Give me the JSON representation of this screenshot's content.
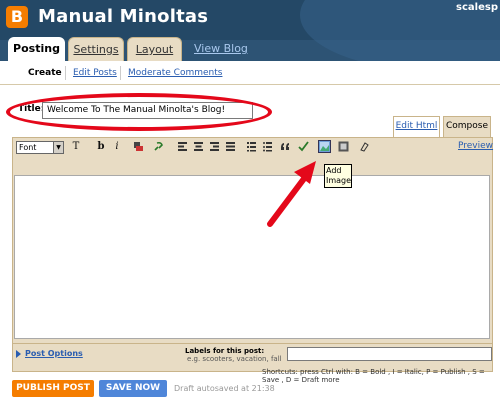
{
  "header": {
    "blog_title": "Manual Minoltas",
    "user": "scalesp",
    "logo_letter": "B"
  },
  "tabs": [
    {
      "label": "Posting"
    },
    {
      "label": "Settings"
    },
    {
      "label": "Layout"
    }
  ],
  "view_blog": "View Blog",
  "subnav": {
    "create": "Create",
    "edit_posts": "Edit Posts",
    "moderate_comments": "Moderate Comments"
  },
  "post": {
    "title_label": "Title:",
    "title_value": "Welcome To The Manual Minolta's Blog!"
  },
  "editor_tabs": {
    "edit_html": "Edit Html",
    "compose": "Compose"
  },
  "toolbar": {
    "font_label": "Font",
    "size_label": "T",
    "bold": "b",
    "italic": "i",
    "preview": "Preview"
  },
  "tooltip": "Add Image",
  "bottom": {
    "post_options": "Post Options",
    "labels_title": "Labels for this post:",
    "labels_example": "e.g. scooters, vacation, fall"
  },
  "shortcuts": "Shortcuts: press Ctrl with: B = Bold , I = Italic, P = Publish , S = Save , D = Draft more",
  "buttons": {
    "publish": "PUBLISH POST",
    "save": "SAVE NOW"
  },
  "draft_status": "Draft autosaved at 21:38",
  "colors": {
    "header_bg": "#2d5374",
    "tab_bg": "#e8dcc4",
    "link": "#2a5db0",
    "publish": "#f57d00",
    "save": "#4f86d9",
    "annotation_red": "#e4081a"
  }
}
